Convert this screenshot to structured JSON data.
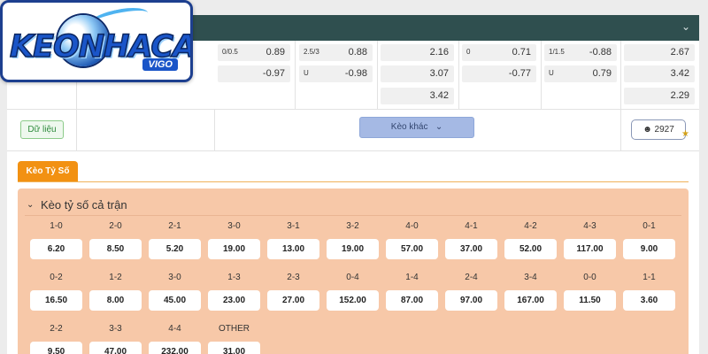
{
  "logo": {
    "brand": "KEONHACAI",
    "sub": "VIGO"
  },
  "odds": {
    "col1": [
      {
        "label": "0/0.5",
        "value": "0.89"
      },
      {
        "label": "",
        "value": "-0.97"
      }
    ],
    "col2": [
      {
        "label": "2.5/3",
        "value": "0.88"
      },
      {
        "label": "U",
        "value": "-0.98"
      }
    ],
    "col3": [
      "2.16",
      "3.07",
      "3.42"
    ],
    "col4": [
      {
        "label": "0",
        "value": "0.71"
      },
      {
        "label": "",
        "value": "-0.77"
      }
    ],
    "col5": [
      {
        "label": "1/1.5",
        "value": "-0.88"
      },
      {
        "label": "U",
        "value": "0.79"
      }
    ],
    "col6": [
      "2.67",
      "3.42",
      "2.29"
    ]
  },
  "actions": {
    "data_label": "Dữ liệu",
    "more_label": "Kèo khác",
    "count": "2927"
  },
  "tab": {
    "label": "Kèo Tỷ Số"
  },
  "section": {
    "title": "Kèo tỷ số cả trận"
  },
  "scores": [
    {
      "s": "1-0",
      "o": "6.20"
    },
    {
      "s": "2-0",
      "o": "8.50"
    },
    {
      "s": "2-1",
      "o": "5.20"
    },
    {
      "s": "3-0",
      "o": "19.00"
    },
    {
      "s": "3-1",
      "o": "13.00"
    },
    {
      "s": "3-2",
      "o": "19.00"
    },
    {
      "s": "4-0",
      "o": "57.00"
    },
    {
      "s": "4-1",
      "o": "37.00"
    },
    {
      "s": "4-2",
      "o": "52.00"
    },
    {
      "s": "4-3",
      "o": "117.00"
    },
    {
      "s": "0-1",
      "o": "9.00"
    },
    {
      "s": "0-2",
      "o": "16.50"
    },
    {
      "s": "1-2",
      "o": "8.00"
    },
    {
      "s": "3-0",
      "o": "45.00"
    },
    {
      "s": "1-3",
      "o": "23.00"
    },
    {
      "s": "2-3",
      "o": "27.00"
    },
    {
      "s": "0-4",
      "o": "152.00"
    },
    {
      "s": "1-4",
      "o": "87.00"
    },
    {
      "s": "2-4",
      "o": "97.00"
    },
    {
      "s": "3-4",
      "o": "167.00"
    },
    {
      "s": "0-0",
      "o": "11.50"
    },
    {
      "s": "1-1",
      "o": "3.60"
    },
    {
      "s": "2-2",
      "o": "9.50"
    },
    {
      "s": "3-3",
      "o": "47.00"
    },
    {
      "s": "4-4",
      "o": "232.00"
    },
    {
      "s": "OTHER",
      "o": "31.00"
    }
  ],
  "colors": {
    "header_bar": "#2f4f4f",
    "tab": "#f29112",
    "section_bg": "#f7c8a8",
    "brand_blue": "#1a55c8"
  }
}
